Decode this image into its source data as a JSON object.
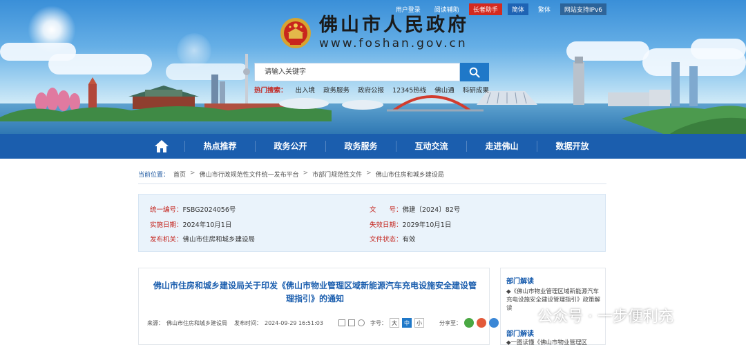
{
  "utility_bar": {
    "login": "用户登录",
    "reading_aid": "阅读辅助",
    "elder_mode": "长者助手",
    "simplified": "简体",
    "traditional": "繁体",
    "ipv6": "网站支持IPv6"
  },
  "brand": {
    "title": "佛山市人民政府",
    "url": "www.foshan.gov.cn"
  },
  "search": {
    "placeholder": "请输入关键字",
    "hot_label": "热门搜索：",
    "hot_items": [
      "出入境",
      "政务服务",
      "政府公报",
      "12345热线",
      "佛山通",
      "科研成果"
    ]
  },
  "nav": {
    "items": [
      "热点推荐",
      "政务公开",
      "政务服务",
      "互动交流",
      "走进佛山",
      "数据开放"
    ]
  },
  "breadcrumb": {
    "label": "当前位置：",
    "items": [
      "首页",
      "佛山市行政规范性文件统一发布平台",
      "市部门规范性文件",
      "佛山市住房和城乡建设局"
    ]
  },
  "doc_info": {
    "code_key": "统一编号：",
    "code_val": "FSBG2024056号",
    "num_key": "文　　号：",
    "num_val": "佛建〔2024〕82号",
    "start_key": "实施日期：",
    "start_val": "2024年10月1日",
    "end_key": "失效日期：",
    "end_val": "2029年10月1日",
    "issuer_key": "发布机关：",
    "issuer_val": "佛山市住房和城乡建设局",
    "status_key": "文件状态：",
    "status_val": "有效"
  },
  "article": {
    "title": "佛山市住房和城乡建设局关于印发《佛山市物业管理区域新能源汽车充电设施安全建设管理指引》的通知",
    "source_label": "来源：",
    "source": "佛山市住房和城乡建设局",
    "time_label": "发布时间：",
    "time": "2024-09-29 16:51:03",
    "font_label": "字号：",
    "font_large": "大",
    "font_medium": "中",
    "font_small": "小",
    "share_label": "分享至："
  },
  "sidebar": {
    "section1_title": "部门解读",
    "section1_text": "◆《佛山市物业管理区域新能源汽车充电设施安全建设管理指引》政策解读",
    "section2_title": "部门解读",
    "section2_text": "◆一图读懂《佛山市物业管理区"
  },
  "watermark": {
    "text": "公众号 · 一步便利充"
  },
  "colors": {
    "nav_blue": "#1b5eae",
    "accent_red": "#c4231c",
    "search_blue": "#1f78c8"
  }
}
